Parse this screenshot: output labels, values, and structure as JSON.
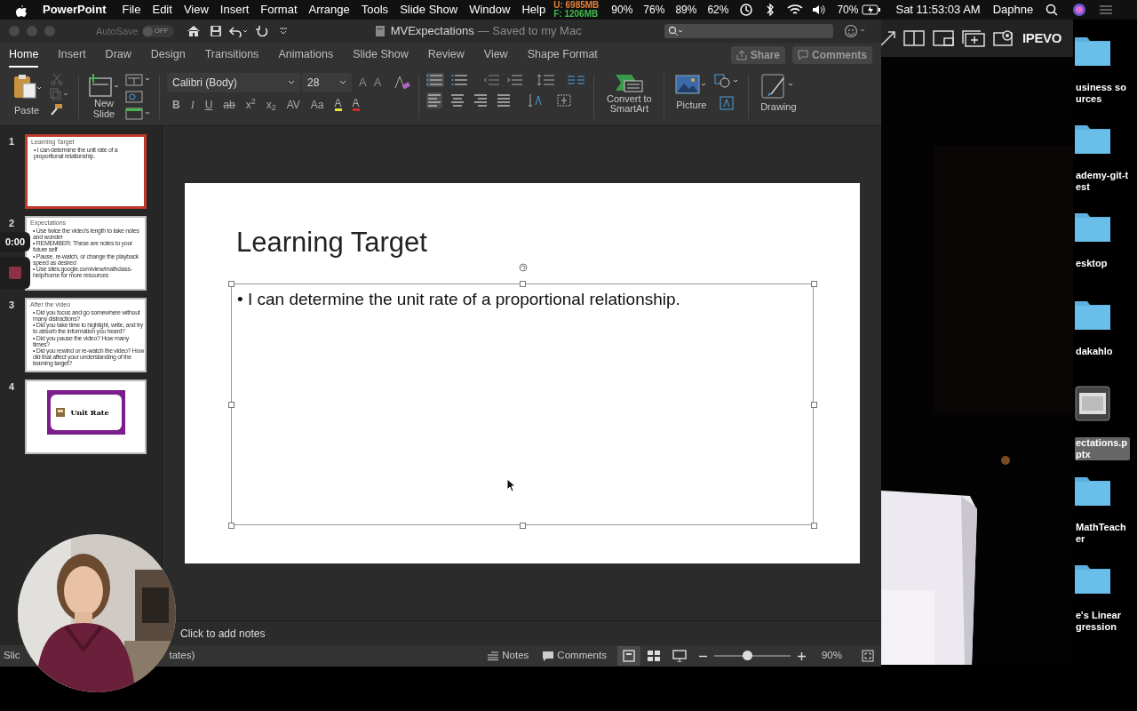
{
  "menu_bar": {
    "app": "PowerPoint",
    "items": [
      "File",
      "Edit",
      "View",
      "Insert",
      "Format",
      "Arrange",
      "Tools",
      "Slide Show",
      "Window",
      "Help"
    ],
    "memory": [
      {
        "label": "U: 6985MB",
        "color": "#e8803a"
      },
      {
        "label": "F: 1206MB",
        "color": "#43b84e"
      }
    ],
    "meters": [
      "90%",
      "76%",
      "89%",
      "62%"
    ],
    "battery": "70%",
    "clock": "Sat 11:53:03 AM",
    "user": "Daphne"
  },
  "window": {
    "title": "MVExpectations",
    "subtitle": "— Saved to my Mac",
    "autosave": {
      "label": "AutoSave",
      "on": false,
      "state_label": "OFF"
    }
  },
  "ribbon": {
    "tabs": [
      {
        "label": "Home",
        "selected": true
      },
      {
        "label": "Insert",
        "selected": false
      },
      {
        "label": "Draw",
        "selected": false
      },
      {
        "label": "Design",
        "selected": false
      },
      {
        "label": "Transitions",
        "selected": false
      },
      {
        "label": "Animations",
        "selected": false
      },
      {
        "label": "Slide Show",
        "selected": false
      },
      {
        "label": "Review",
        "selected": false
      },
      {
        "label": "View",
        "selected": false
      },
      {
        "label": "Shape Format",
        "selected": false
      }
    ],
    "share": "Share",
    "comments": "Comments",
    "paste": "Paste",
    "new_slide": "New Slide",
    "font": "Calibri (Body)",
    "size": "28",
    "grow_shrink": [
      "A",
      "A"
    ],
    "format_buttons": [
      "B",
      "I",
      "U",
      "ab",
      "x$^{2}$",
      "x$_{2}$",
      "AV",
      "Aa"
    ],
    "highlight": "A",
    "font_color": "A",
    "smartart": "Convert to SmartArt",
    "picture": "Picture",
    "drawing": "Drawing"
  },
  "slides": [
    {
      "number": "1",
      "selected": true,
      "kind": "bullets",
      "title": "Learning Target",
      "bullets": [
        "• I can determine the unit rate of a proportional relationship."
      ]
    },
    {
      "number": "2",
      "selected": false,
      "kind": "bullets",
      "title": "Expectations",
      "bullets": [
        "• Use twice the video's length to take notes and wonder",
        "• REMEMBER: These are notes to your future self",
        "• Pause, re-watch, or change the playback speed as desired",
        "• Use sites.google.com/view/mathclass-help/home for more resources"
      ]
    },
    {
      "number": "3",
      "selected": false,
      "kind": "bullets",
      "title": "After the video",
      "bullets": [
        "• Did you focus and go somewhere without many distractions?",
        "• Did you take time to highlight, write, and try to absorb the information you heard?",
        "• Did you pause the video? How many times?",
        "• Did you rewind or re-watch the video? How did that affect your understanding of the learning target?"
      ]
    },
    {
      "number": "4",
      "selected": false,
      "kind": "title_card",
      "title": "Unit Rate"
    }
  ],
  "editor": {
    "title": "Learning Target",
    "bullet": "• I can determine the unit rate of a proportional relationship."
  },
  "notes": {
    "placeholder": "Click to add notes"
  },
  "status_bar": {
    "left": [
      "Slic",
      "tates)"
    ],
    "notes": "Notes",
    "comments": "Comments",
    "zoom": {
      "level": 0.43,
      "reading": "90%"
    }
  },
  "recorder": {
    "time": "0:00"
  },
  "camera_app": {
    "logo": "IPEVO"
  },
  "desktop": [
    {
      "kind": "folder",
      "label": "usiness sources",
      "selected": false
    },
    {
      "kind": "folder",
      "label": "ademy-git-test",
      "selected": false
    },
    {
      "kind": "folder",
      "label": "esktop",
      "selected": false
    },
    {
      "kind": "folder",
      "label": "dakahlo",
      "selected": false
    },
    {
      "kind": "file",
      "label": "ectations.pptx",
      "selected": true
    },
    {
      "kind": "folder",
      "label": "MathTeacher",
      "selected": false
    },
    {
      "kind": "folder",
      "label": "e's Linear gression",
      "selected": false
    }
  ]
}
